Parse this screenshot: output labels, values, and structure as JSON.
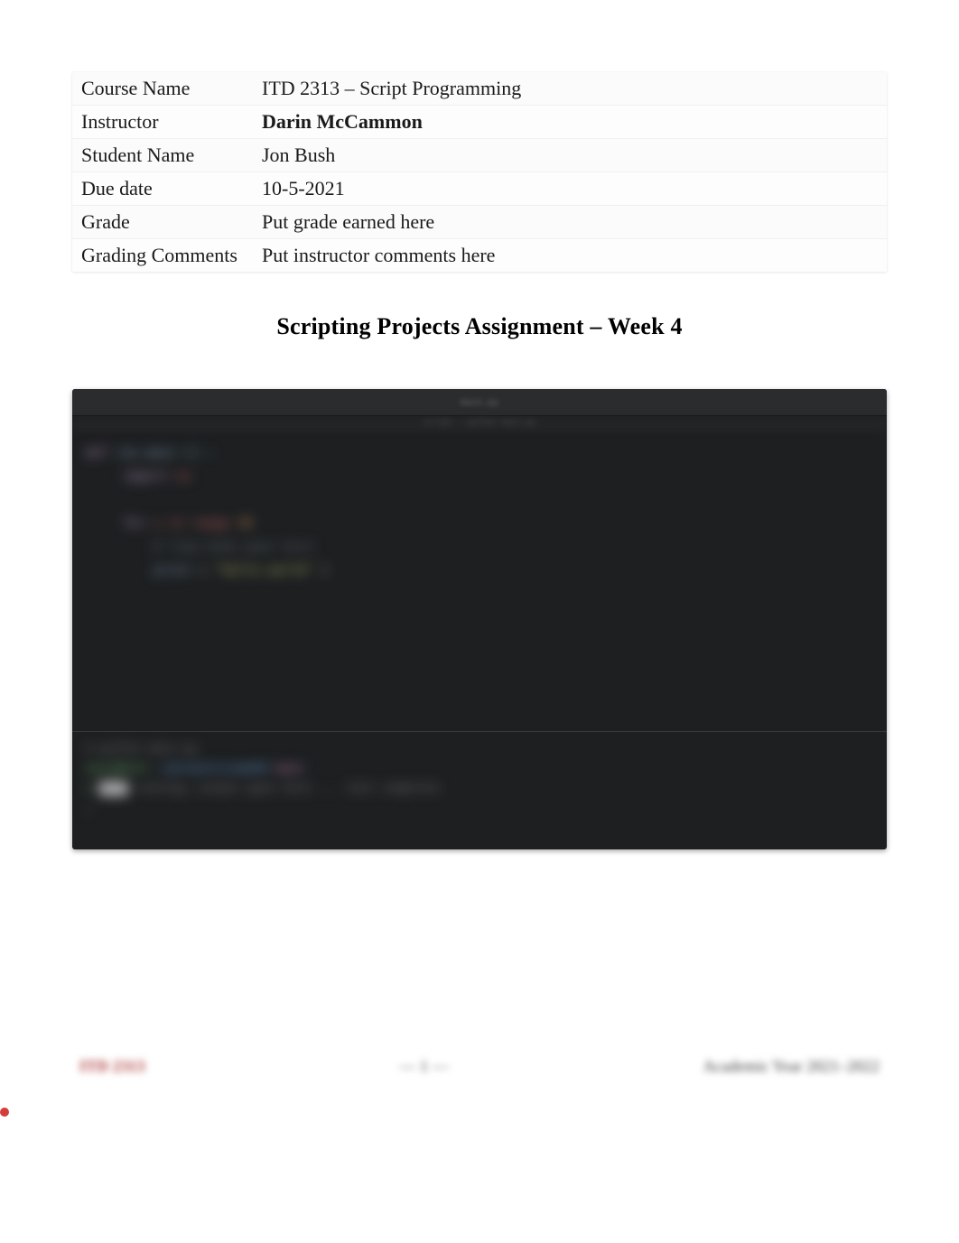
{
  "info_rows": [
    {
      "label": "Course Name",
      "value": "ITD 2313 – Script Programming",
      "bold": false
    },
    {
      "label": "Instructor",
      "value": "Darin McCammon",
      "bold": true
    },
    {
      "label": "Student Name",
      "value": "Jon Bush",
      "bold": false
    },
    {
      "label": "Due date",
      "value": "10-5-2021",
      "bold": false
    },
    {
      "label": "Grade",
      "value": "Put grade earned here",
      "bold": false
    },
    {
      "label": "Grading Comments",
      "value": "Put instructor comments here",
      "bold": false
    }
  ],
  "assignment_title": "Scripting Projects Assignment – Week 4",
  "screenshot": {
    "window_title": "main.py",
    "subheader": "script — python main.py",
    "code_tokens_top": "def",
    "code_tokens_fn": "run_main",
    "code_tokens_paren": "() :",
    "code_line2_kw": "import",
    "code_line2_id": "os",
    "code_line3_kw": "for",
    "code_line3_rest": "x in range",
    "code_line3_num": "10",
    "code_line4_cm": "# loop body goes here",
    "code_line5_kw": "print",
    "code_line5_str": "\"hello world\"",
    "terminal_line1": "$  python  main.py",
    "terminal_prompt": "user@host",
    "terminal_path": "~/projects/week4",
    "terminal_status": "main",
    "terminal_output": "running…  output  goes  here  ...  test  complete."
  },
  "footer": {
    "left": "ITD 2313",
    "center": "— 1 —",
    "right": "Academic Year 2021–2022"
  }
}
